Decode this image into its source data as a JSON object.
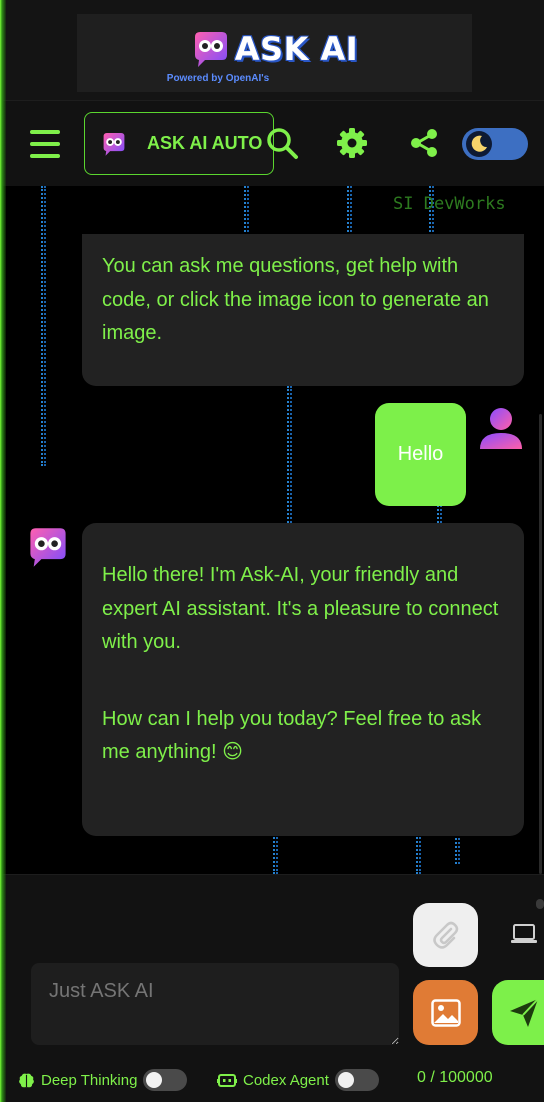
{
  "brand": {
    "title": "ASK AI",
    "subtitle": "Powered by OpenAI's"
  },
  "nav": {
    "mode_label": "ASK AI AUTO",
    "icons": [
      "menu-icon",
      "bot-avatar-icon",
      "search-icon",
      "gear-icon",
      "share-icon",
      "moon-icon"
    ],
    "theme": "dark"
  },
  "chat": {
    "watermark": "SI DevWorks",
    "messages": [
      {
        "role": "assistant",
        "text": "You can ask me questions, get help with code, or click the image icon to generate an image."
      },
      {
        "role": "user",
        "text": "Hello"
      },
      {
        "role": "assistant",
        "paragraphs": [
          "Hello there! I'm Ask-AI, your friendly and expert AI assistant. It's a pleasure to connect with you.",
          "How can I help you today? Feel free to ask me anything! 😊"
        ]
      }
    ]
  },
  "composer": {
    "placeholder": "Just ASK AI",
    "buttons": [
      "paperclip-icon",
      "laptop-icon",
      "image-icon",
      "send-icon"
    ]
  },
  "footer": {
    "deep_thinking_label": "Deep Thinking",
    "deep_thinking_on": false,
    "codex_agent_label": "Codex Agent",
    "codex_agent_on": false,
    "char_counter": "0 / 100000"
  },
  "colors": {
    "accent": "#7ff04a",
    "bubble": "#222222",
    "image_button": "#e07b35",
    "toggle": "#3d6fc2"
  }
}
